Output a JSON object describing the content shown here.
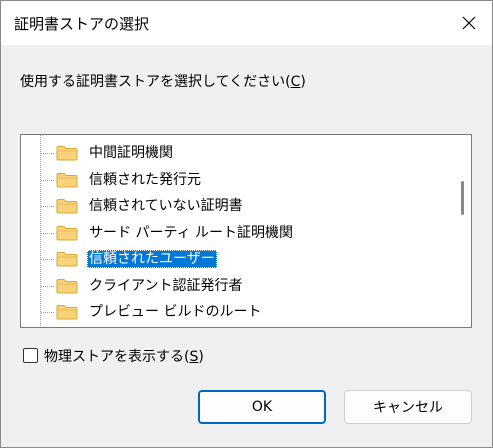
{
  "window": {
    "title": "証明書ストアの選択",
    "close_icon": "close-icon"
  },
  "prompt": {
    "text": "使用する証明書ストアを選択してください(",
    "mnemonic": "C",
    "suffix": ")"
  },
  "tree": {
    "items": [
      {
        "label": "中間証明機関",
        "selected": false
      },
      {
        "label": "信頼された発行元",
        "selected": false
      },
      {
        "label": "信頼されていない証明書",
        "selected": false
      },
      {
        "label": "サード パーティ ルート証明機関",
        "selected": false
      },
      {
        "label": "信頼されたユーザー",
        "selected": true
      },
      {
        "label": "クライアント認証発行者",
        "selected": false
      },
      {
        "label": "プレビュー ビルドのルート",
        "selected": false
      }
    ],
    "folder_icon": "folder-icon",
    "accent": "#0078d7"
  },
  "physical": {
    "text": "物理ストアを表示する(",
    "mnemonic": "S",
    "suffix": ")",
    "checked": false
  },
  "buttons": {
    "ok": "OK",
    "cancel": "キャンセル"
  }
}
